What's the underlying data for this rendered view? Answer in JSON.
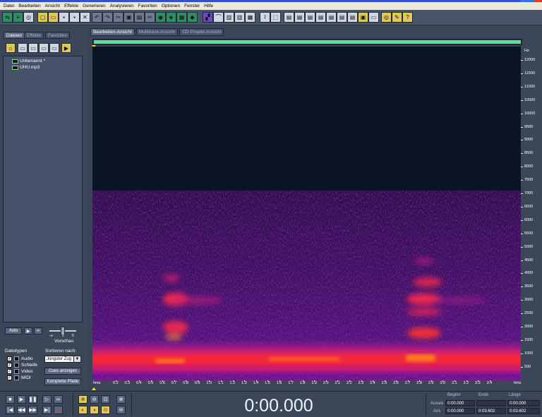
{
  "menu": [
    "Datei",
    "Bearbeiten",
    "Ansicht",
    "Effekte",
    "Generieren",
    "Analysieren",
    "Favoriten",
    "Optionen",
    "Fenster",
    "Hilfe"
  ],
  "left_tabs": [
    "Dateien",
    "Effekte",
    "Favoriten"
  ],
  "files": [
    "Unbenannt *",
    "UHU.mp3"
  ],
  "left_controls": {
    "auto_label": "Auto",
    "preview_label": "Vorschau",
    "slider_marks": [
      "-∞",
      "0",
      "6"
    ]
  },
  "filetypes": {
    "title": "Dateitypen",
    "items": [
      "Audio",
      "Schleife",
      "Video",
      "MIDI"
    ]
  },
  "sort": {
    "title": "Sortieren nach:",
    "selected": "Jüngster Zug",
    "btn_show_cues": "Cues anzeigen",
    "btn_full_paths": "Komplette Pfade"
  },
  "main_tabs": [
    "Bearbeiten-Ansicht",
    "Multitrack-Ansicht",
    "CD-Projekt-Ansicht"
  ],
  "hz_ruler": {
    "unit": "Hz",
    "labels": [
      "12000",
      "11500",
      "11000",
      "10500",
      "10000",
      "9500",
      "9000",
      "8500",
      "8000",
      "7500",
      "7000",
      "6500",
      "6000",
      "5500",
      "5000",
      "4500",
      "4000",
      "3500",
      "3000",
      "2500",
      "2000",
      "1500",
      "1000",
      "500"
    ]
  },
  "time_ruler": {
    "unit": "hms",
    "labels": [
      "0.2",
      "0.3",
      "0.4",
      "0.5",
      "0.6",
      "0.7",
      "0.8",
      "0.9",
      "1.0",
      "1.1",
      "1.2",
      "1.3",
      "1.4",
      "1.5",
      "1.6",
      "1.7",
      "1.8",
      "1.9",
      "2.0",
      "2.1",
      "2.2",
      "2.3",
      "2.4",
      "2.5",
      "2.6",
      "2.7",
      "2.8",
      "2.9",
      "3.0",
      "3.1",
      "3.2",
      "3.3",
      "3.4"
    ]
  },
  "timecode": "0:00.000",
  "selection": {
    "headers": [
      "Beginn",
      "Ende",
      "Länge"
    ],
    "rows": [
      {
        "label": "Auswa",
        "values": [
          "0:00.000",
          "",
          "0:00.000"
        ]
      },
      {
        "label": "Ans",
        "values": [
          "0:00.000",
          "0:03.602",
          "0:03.602"
        ]
      }
    ]
  }
}
